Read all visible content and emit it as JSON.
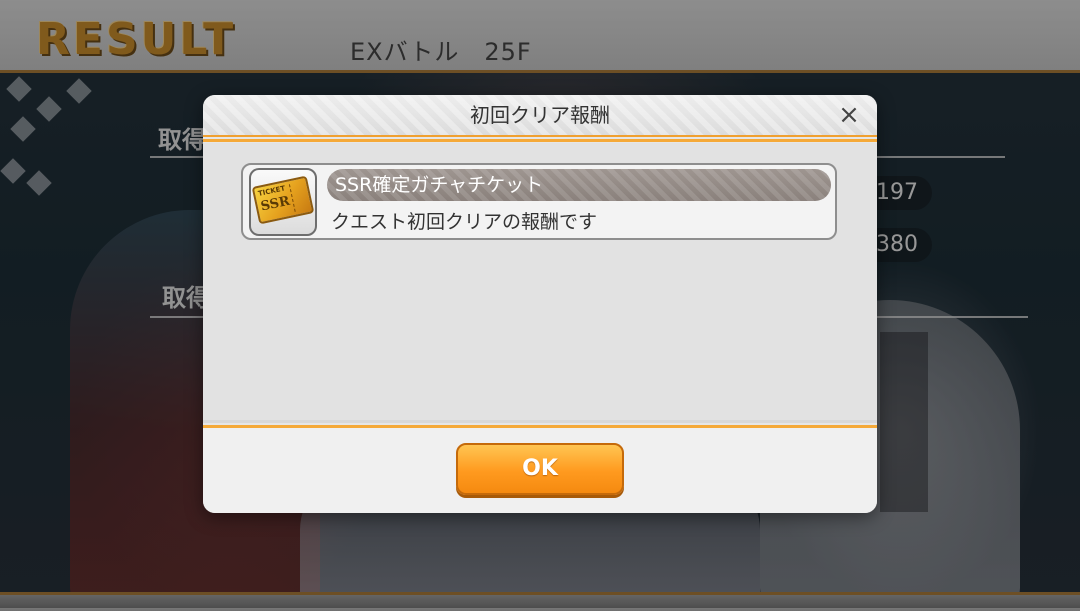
{
  "header": {
    "logo_text": "RESULT",
    "stage_title": "EXバトル　25F"
  },
  "background": {
    "heading_1": "取得",
    "heading_2": "取得",
    "value_1": "197",
    "value_2": "380"
  },
  "modal": {
    "title": "初回クリア報酬",
    "close_symbol": "×",
    "reward": {
      "name": "SSR確定ガチャチケット",
      "description": "クエスト初回クリアの報酬です",
      "icon": "ssr-gacha-ticket-icon",
      "icon_text_ticket": "TICKET",
      "icon_text_ssr": "SSR"
    },
    "ok_label": "OK"
  },
  "colors": {
    "accent_orange": "#f5a938",
    "button_orange": "#ff9a1f",
    "logo_gold": "#c58a2c"
  }
}
